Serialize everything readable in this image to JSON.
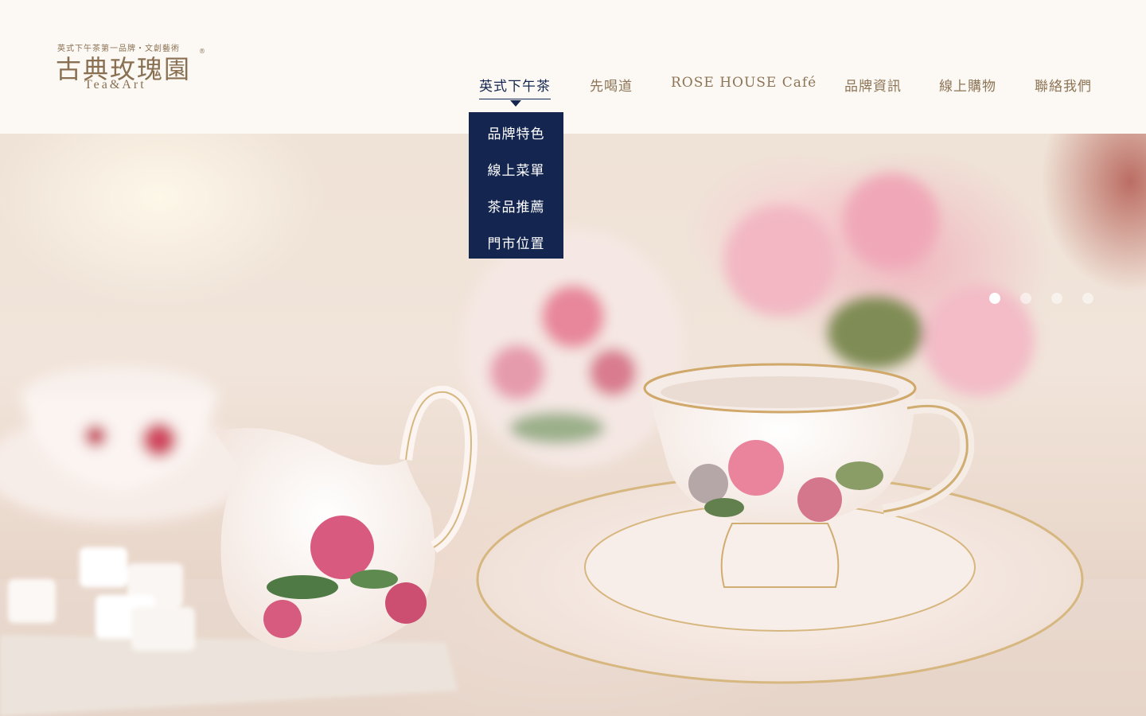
{
  "brand": {
    "tagline": "英式下午茶第一品牌・文創藝術",
    "name": "古典玫瑰園",
    "registered": "®",
    "sub": "Tea&Art"
  },
  "nav": {
    "items": [
      {
        "label": "英式下午茶",
        "active": true
      },
      {
        "label": "先喝道"
      },
      {
        "label": "ROSE HOUSE Café"
      },
      {
        "label": "品牌資訊"
      },
      {
        "label": "線上購物"
      },
      {
        "label": "聯絡我們"
      }
    ]
  },
  "dropdown": {
    "items": [
      "品牌特色",
      "線上菜單",
      "茶品推薦",
      "門市位置"
    ]
  },
  "slider": {
    "count": 4,
    "active_index": 0
  },
  "colors": {
    "navy": "#142650",
    "gold": "#8d7456",
    "header_bg": "#fcf9f4"
  },
  "hero": {
    "image_description_icon": "teacup-photo"
  }
}
